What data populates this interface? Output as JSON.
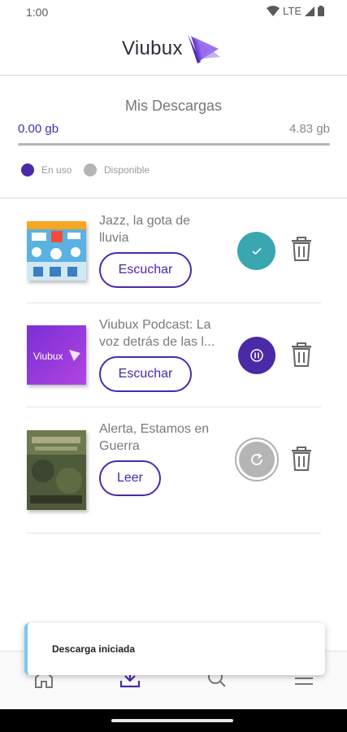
{
  "status_bar": {
    "time": "1:00",
    "network": "LTE"
  },
  "logo": {
    "text": "Viubux"
  },
  "downloads": {
    "title": "Mis Descargas",
    "used": "0.00 gb",
    "total": "4.83 gb",
    "used_fraction": 0.0,
    "legend": {
      "in_use": "En uso",
      "available": "Disponible"
    },
    "colors": {
      "in_use": "#4b2aa8",
      "available": "#b5b5b5"
    }
  },
  "items": [
    {
      "title_line1": "Jazz, la gota de",
      "title_line2": "lluvia",
      "action": "Escuchar",
      "status": "completed",
      "status_icon": "check-icon"
    },
    {
      "title_line1": "Viubux Podcast: La",
      "title_line2": "voz detrás de las l...",
      "action": "Escuchar",
      "status": "downloading",
      "status_icon": "pause-icon",
      "thumb_text": "Viubux"
    },
    {
      "title_line1": "Alerta, Estamos en",
      "title_line2": "Guerra",
      "action": "Leer",
      "status": "pending",
      "status_icon": "refresh-icon"
    }
  ],
  "toast": {
    "message": "Descarga iniciada"
  },
  "tabs": [
    "home-icon",
    "download-icon",
    "search-icon",
    "menu-icon"
  ],
  "accent": "#4b2aa8",
  "teal": "#3aa6b0"
}
